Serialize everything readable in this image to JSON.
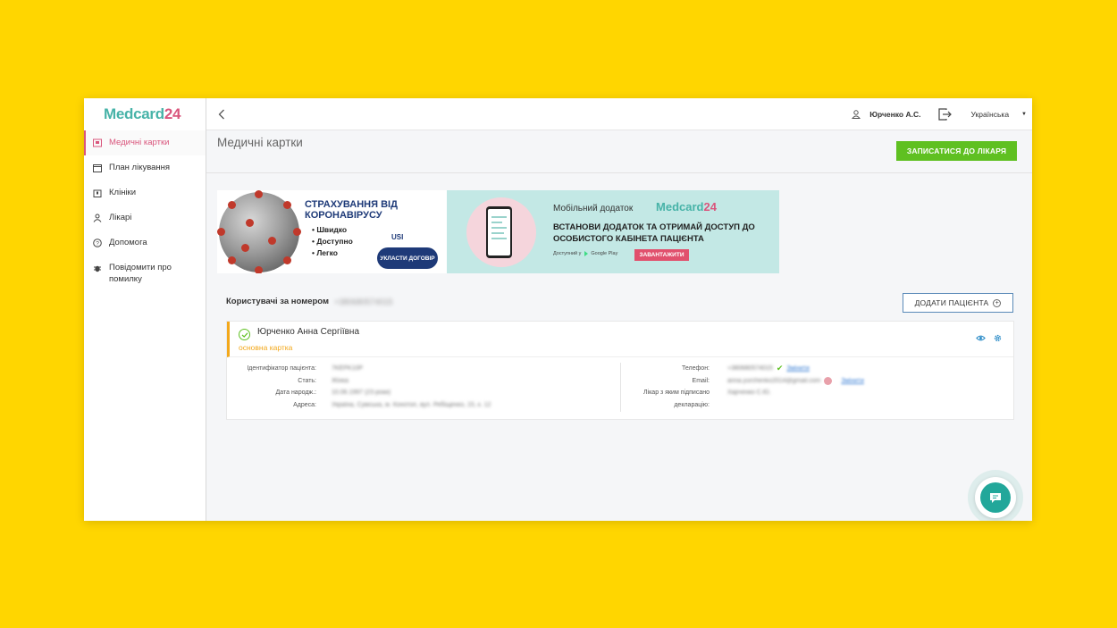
{
  "brand": {
    "logo_prefix": "M",
    "logo_mid": "edcard",
    "logo_num": "24"
  },
  "sidebar": {
    "items": [
      {
        "label": "Медичні картки",
        "icon": "medical-card-icon",
        "active": true
      },
      {
        "label": "План лікування",
        "icon": "calendar-icon",
        "active": false
      },
      {
        "label": "Клініки",
        "icon": "clinic-icon",
        "active": false
      },
      {
        "label": "Лікарі",
        "icon": "doctor-icon",
        "active": false
      },
      {
        "label": "Допомога",
        "icon": "help-icon",
        "active": false
      },
      {
        "label": "Повідомити про помилку",
        "icon": "bug-icon",
        "active": false
      }
    ]
  },
  "topbar": {
    "back_icon": "chevron-left-icon",
    "user_name": "Юрченко А.С.",
    "user_icon": "user-icon",
    "logout_icon": "logout-icon",
    "language": "Українська"
  },
  "page": {
    "title": "Медичні картки",
    "cta_label": "ЗАПИСАТИСЯ ДО ЛІКАРЯ",
    "cta_color": "#5FC021"
  },
  "banners": {
    "insurance": {
      "title": "СТРАХУВАННЯ ВІД КОРОНАВІРУСУ",
      "points": [
        "• Швидко",
        "• Доступно",
        "• Легко"
      ],
      "brand": "USI",
      "button": "УКЛАСТИ ДОГОВІР"
    },
    "app": {
      "label": "Мобільний додаток",
      "text": "ВСТАНОВИ ДОДАТОК ТА ОТРИМАЙ ДОСТУП ДО ОСОБИСТОГО КАБІНЕТА ПАЦІЄНТА",
      "available": "Доступний у",
      "store": "Google Play",
      "button": "ЗАВАНТАЖИТИ"
    }
  },
  "users": {
    "label": "Користувачі за номером",
    "phone": "+380680574015",
    "add_button": "ДОДАТИ ПАЦІЄНТА"
  },
  "patient": {
    "name": "Юрченко Анна Сергіївна",
    "card_type": "основна картка",
    "fields_left": [
      {
        "label": "Ідентифікатор пацієнта:",
        "value": "7KEPK10P"
      },
      {
        "label": "Стать:",
        "value": "Жінка"
      },
      {
        "label": "Дата народж.:",
        "value": "10.06.1997 (23 роки)"
      },
      {
        "label": "Адреса:",
        "value": "Україна, Сумська, м. Конотоп, вул. Ребіщенко, 15, к. 12"
      }
    ],
    "phone_label": "Телефон:",
    "phone_value": "+380680574015",
    "email_label": "Email:",
    "email_value": "anna.yurchenko2014@gmail.com",
    "change_label": "Змінити",
    "doctor_label": "Лікар з яким підписано декларацію:",
    "doctor_value": "Харченко С.Ю."
  },
  "accent_colors": {
    "brand_pink": "#D9557C",
    "brand_teal": "#47B3A8",
    "highlight": "#F3A81B"
  }
}
